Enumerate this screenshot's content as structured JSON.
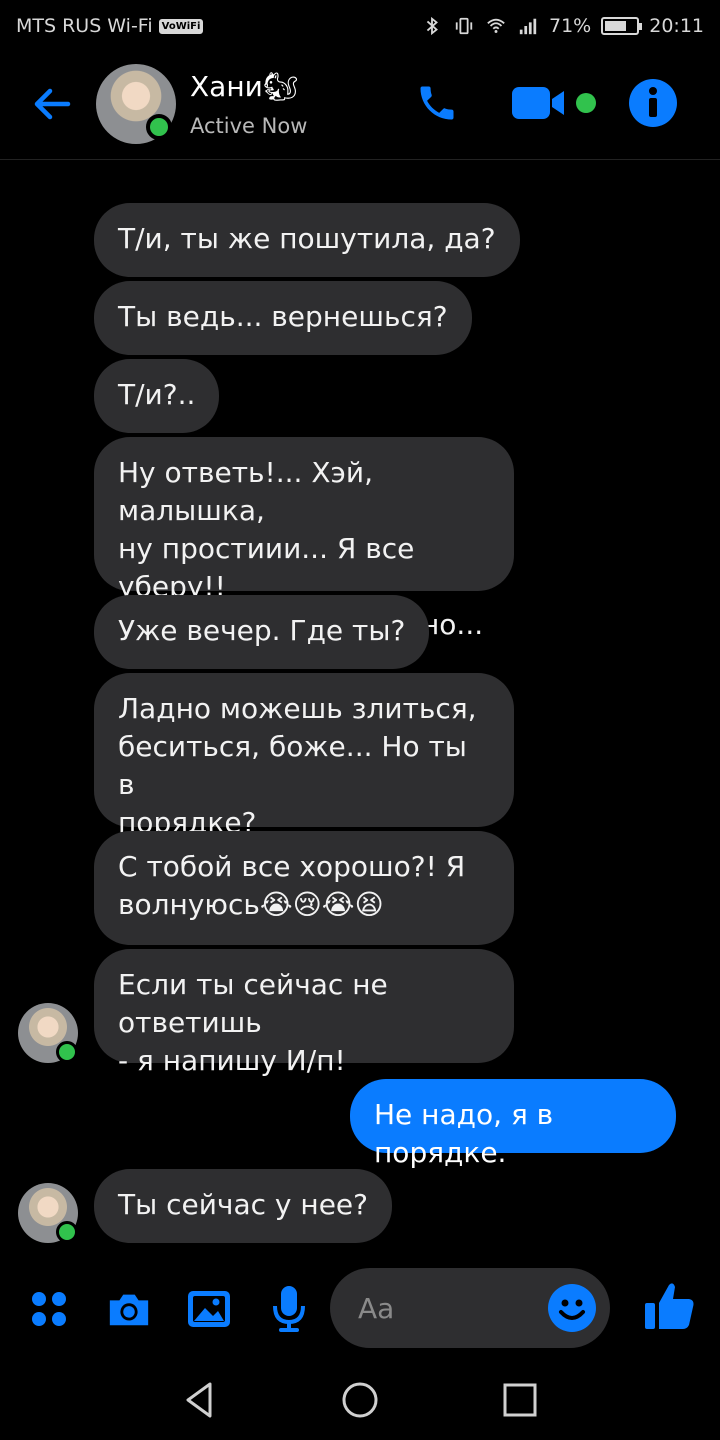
{
  "status_bar": {
    "carrier": "MTS RUS Wi-Fi",
    "volte": "VoWiFi",
    "battery": "71%",
    "battery_level": 0.71,
    "time": "20:11"
  },
  "header": {
    "name": "Хани🐿",
    "status": "Active Now"
  },
  "messages": [
    {
      "dir": "in",
      "text": "Т/и, ты же пошутила, да?"
    },
    {
      "dir": "in",
      "text": "Ты ведь... вернешься?"
    },
    {
      "dir": "in",
      "text": "Т/и?.."
    },
    {
      "dir": "in",
      "text": "Ну ответь!... Хэй, малышка,\nну простиии... Я все уберу!!\nЭто ведь не так важно..."
    },
    {
      "dir": "in",
      "text": "Уже вечер. Где ты?"
    },
    {
      "dir": "in",
      "text": "Ладно можешь злиться,\nбеситься, боже... Но ты в\nпорядке?"
    },
    {
      "dir": "in",
      "text": "С тобой все хорошо?! Я\nволнуюсь😭😢😭😫"
    },
    {
      "dir": "in",
      "text": "Если ты сейчас не ответишь\n- я напишу И/п!"
    },
    {
      "dir": "out",
      "text": "Не надо, я в порядке."
    },
    {
      "dir": "in",
      "text": "Ты сейчас у нее?"
    }
  ],
  "composer": {
    "placeholder": "Aa"
  },
  "colors": {
    "accent": "#0a7cff",
    "incoming_bubble": "#2e2e30",
    "online": "#31c24d",
    "background": "#000000"
  },
  "icons": [
    "back-arrow-icon",
    "phone-icon",
    "video-camera-icon",
    "info-icon",
    "apps-icon",
    "camera-icon",
    "image-icon",
    "microphone-icon",
    "emoji-icon",
    "thumbs-up-icon",
    "nav-back-icon",
    "nav-home-icon",
    "nav-recents-icon"
  ]
}
